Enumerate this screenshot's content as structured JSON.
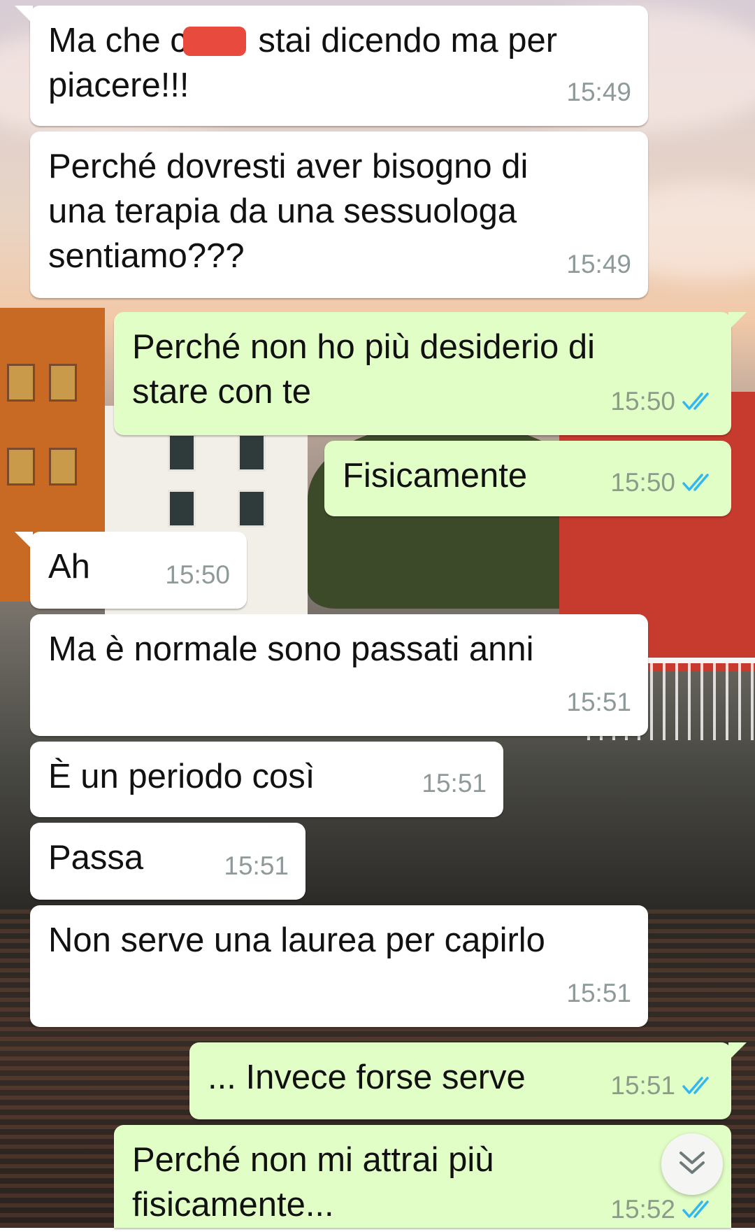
{
  "messages": [
    {
      "text_before": "Ma che c",
      "text_after": " stai dicendo ma per\npiacere!!!",
      "time": "15:49",
      "direction": "incoming",
      "redacted": true
    },
    {
      "text": "Perché dovresti aver bisogno di\nuna terapia da una sessuologa\nsentiamo???",
      "time": "15:49",
      "direction": "incoming"
    },
    {
      "text": "Perché non ho più desiderio di\nstare con te",
      "time": "15:50",
      "direction": "outgoing",
      "status": "read"
    },
    {
      "text": "Fisicamente",
      "time": "15:50",
      "direction": "outgoing",
      "status": "read"
    },
    {
      "text": "Ah",
      "time": "15:50",
      "direction": "incoming"
    },
    {
      "text": "Ma è normale sono passati anni",
      "time": "15:51",
      "direction": "incoming"
    },
    {
      "text": "È un periodo così",
      "time": "15:51",
      "direction": "incoming"
    },
    {
      "text": "Passa",
      "time": "15:51",
      "direction": "incoming"
    },
    {
      "text": "Non serve una laurea per capirlo",
      "time": "15:51",
      "direction": "incoming"
    },
    {
      "text": "... Invece forse serve",
      "time": "15:51",
      "direction": "outgoing",
      "status": "read"
    },
    {
      "text": "Perché non mi attrai più\nfisicamente...",
      "time": "15:52",
      "direction": "outgoing",
      "status": "read"
    }
  ],
  "colors": {
    "incoming_bubble": "#ffffff",
    "outgoing_bubble": "#e1fec6",
    "read_ticks": "#34b7f1",
    "redaction": "#e84a3e"
  },
  "icons": {
    "read_status": "double-check-icon",
    "scroll_down": "chevron-double-down-icon"
  }
}
